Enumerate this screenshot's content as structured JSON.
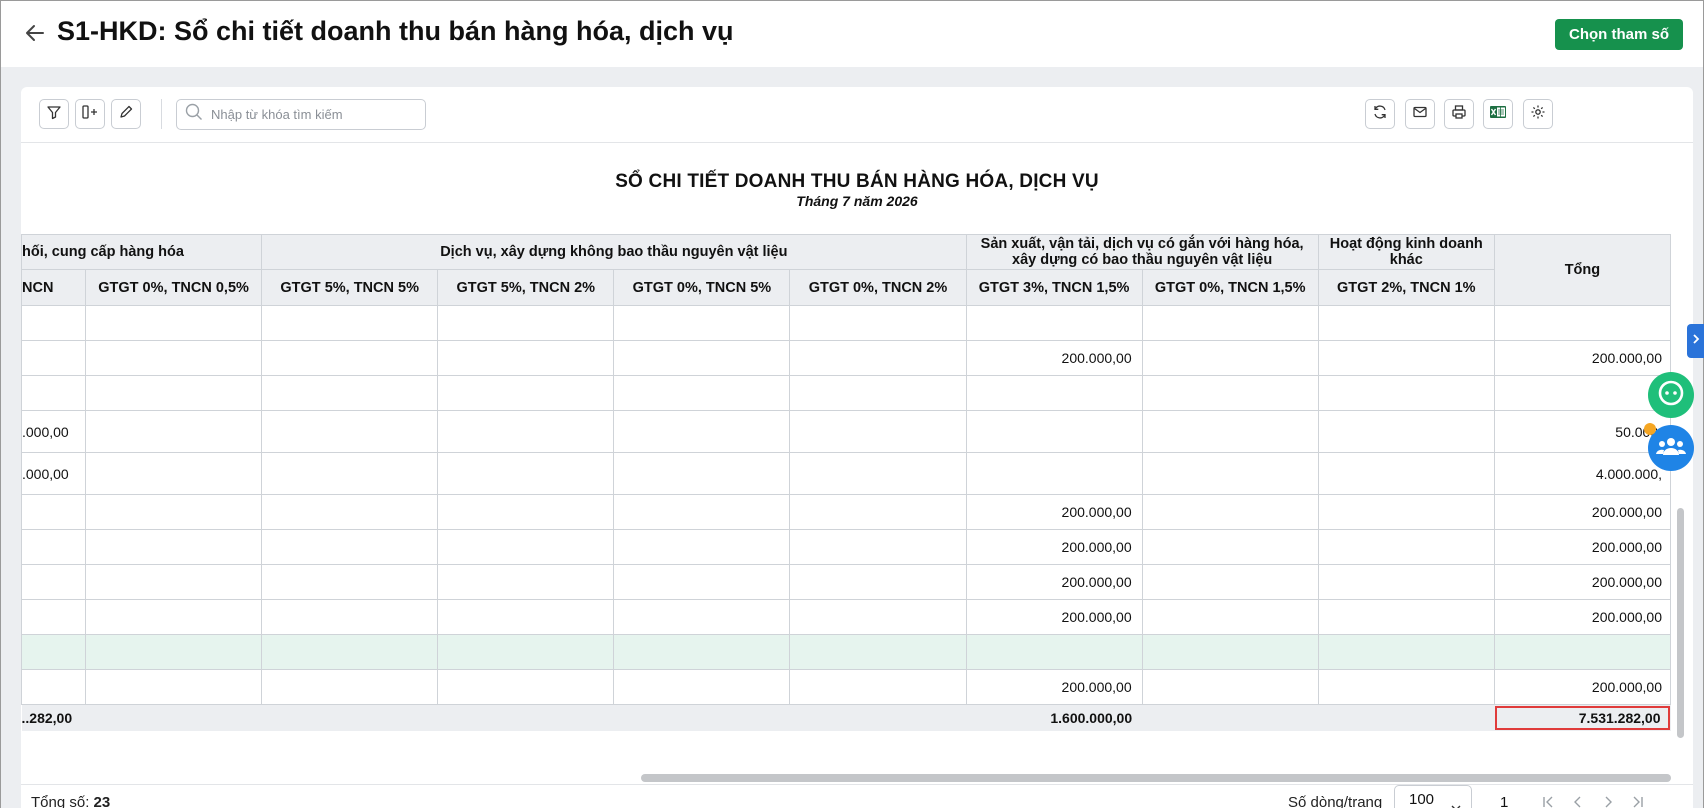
{
  "header": {
    "title": "S1-HKD: Sổ chi tiết doanh thu bán hàng hóa, dịch vụ",
    "choose_params_label": "Chọn tham số"
  },
  "toolbar": {
    "search_placeholder": "Nhập từ khóa tìm kiếm",
    "left_icons": [
      "filter-icon",
      "insert-column-icon",
      "edit-pencil-icon"
    ],
    "right_icons": [
      "refresh-icon",
      "mail-icon",
      "print-icon",
      "excel-icon",
      "settings-icon"
    ]
  },
  "report": {
    "title": "SỔ CHI TIẾT DOANH THU BÁN HÀNG HÓA, DỊCH VỤ",
    "subtitle": "Tháng 7 năm 2026"
  },
  "table": {
    "group_headers": [
      "hối, cung cấp hàng hóa",
      "Dịch vụ, xây dựng không bao thầu nguyên vật liệu",
      "Sản xuất, vận tải, dịch vụ có gắn với hàng hóa, xây dựng có bao thầu nguyên vật liệu",
      "Hoạt động kinh doanh khác",
      "Tổng"
    ],
    "sub_headers": [
      "NCN",
      "GTGT 0%, TNCN 0,5%",
      "GTGT 5%, TNCN 5%",
      "GTGT 5%, TNCN 2%",
      "GTGT 0%, TNCN 5%",
      "GTGT 0%, TNCN 2%",
      "GTGT 3%, TNCN 1,5%",
      "GTGT 0%, TNCN 1,5%",
      "GTGT 2%, TNCN 1%"
    ],
    "rows": [
      [
        "",
        "",
        "",
        "",
        "",
        "",
        "",
        "",
        "",
        ""
      ],
      [
        "",
        "",
        "",
        "",
        "",
        "",
        "200.000,00",
        "",
        "",
        "200.000,00"
      ],
      [
        "",
        "",
        "",
        "",
        "",
        "",
        "",
        "",
        "",
        ""
      ],
      [
        ".000,00",
        "",
        "",
        "",
        "",
        "",
        "",
        "",
        "",
        "50.000,"
      ],
      [
        ".000,00",
        "",
        "",
        "",
        "",
        "",
        "",
        "",
        "",
        "4.000.000,"
      ],
      [
        "",
        "",
        "",
        "",
        "",
        "",
        "200.000,00",
        "",
        "",
        "200.000,00"
      ],
      [
        "",
        "",
        "",
        "",
        "",
        "",
        "200.000,00",
        "",
        "",
        "200.000,00"
      ],
      [
        "",
        "",
        "",
        "",
        "",
        "",
        "200.000,00",
        "",
        "",
        "200.000,00"
      ],
      [
        "",
        "",
        "",
        "",
        "",
        "",
        "200.000,00",
        "",
        "",
        "200.000,00"
      ],
      [
        "",
        "",
        "",
        "",
        "",
        "",
        "",
        "",
        "",
        ""
      ],
      [
        "",
        "",
        "",
        "",
        "",
        "",
        "200.000,00",
        "",
        "",
        "200.000,00"
      ]
    ],
    "totals": [
      "..282,00",
      "",
      "",
      "",
      "",
      "",
      "1.600.000,00",
      "",
      "",
      "7.531.282,00"
    ]
  },
  "footer": {
    "total_label": "Tổng số:",
    "total_value": "23",
    "rows_per_page_label": "Số dòng/trang",
    "rows_per_page_value": "100",
    "current_page": "1"
  },
  "colors": {
    "primary_green": "#16914d",
    "highlight_row": "#e6f4ee",
    "total_outline": "#e03b3b",
    "chat_fab": "#1fbf7a",
    "group_fab": "#1f84e6"
  }
}
